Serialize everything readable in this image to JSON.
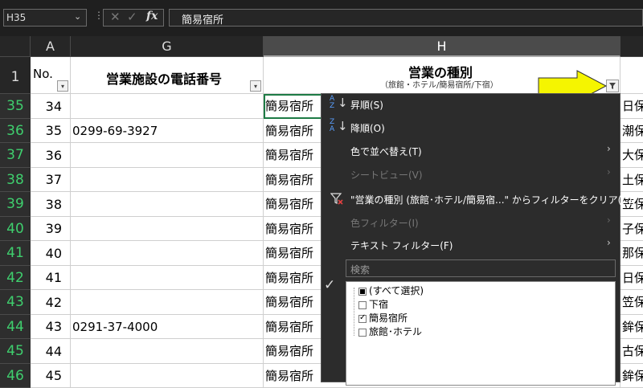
{
  "formula_bar": {
    "name_box": "H35",
    "fx": "fx",
    "content": "簡易宿所"
  },
  "columns": [
    "A",
    "G",
    "H"
  ],
  "header_row": {
    "row_number": "1",
    "A": "No.",
    "G": "営業施設の電話番号",
    "H_title": "営業の種別",
    "H_sub": "（旅館・ホテル/簡易宿所/下宿）"
  },
  "rows": [
    {
      "rn": "35",
      "a": "34",
      "g": "",
      "h": "簡易宿所",
      "i": "日保"
    },
    {
      "rn": "36",
      "a": "35",
      "g": "0299-69-3927",
      "h": "簡易宿所",
      "i": "潮保"
    },
    {
      "rn": "37",
      "a": "36",
      "g": "",
      "h": "簡易宿所",
      "i": "大保"
    },
    {
      "rn": "38",
      "a": "37",
      "g": "",
      "h": "簡易宿所",
      "i": "土保"
    },
    {
      "rn": "39",
      "a": "38",
      "g": "",
      "h": "簡易宿所",
      "i": "笠保"
    },
    {
      "rn": "40",
      "a": "39",
      "g": "",
      "h": "簡易宿所",
      "i": "子保"
    },
    {
      "rn": "41",
      "a": "40",
      "g": "",
      "h": "簡易宿所",
      "i": "那保"
    },
    {
      "rn": "42",
      "a": "41",
      "g": "",
      "h": "簡易宿所",
      "i": "日保"
    },
    {
      "rn": "43",
      "a": "42",
      "g": "",
      "h": "簡易宿所",
      "i": "笠保"
    },
    {
      "rn": "44",
      "a": "43",
      "g": "0291-37-4000",
      "h": "簡易宿所",
      "i": "鉾保"
    },
    {
      "rn": "45",
      "a": "44",
      "g": "",
      "h": "簡易宿所",
      "i": "古保"
    },
    {
      "rn": "46",
      "a": "45",
      "g": "",
      "h": "簡易宿所",
      "i": "鉾保"
    }
  ],
  "menu": {
    "sort_asc": "昇順(S)",
    "sort_desc": "降順(O)",
    "sort_by_color": "色で並べ替え(T)",
    "sheet_view": "シートビュー(V)",
    "clear_filter": "\"営業の種別 (旅館･ホテル/簡易宿...\" からフィルターをクリア(C)",
    "filter_by_color": "色フィルター(I)",
    "text_filter": "テキスト フィルター(F)",
    "search_placeholder": "検索",
    "list": [
      "(すべて選択)",
      "下宿",
      "簡易宿所",
      "旅館･ホテル"
    ]
  },
  "colors": {
    "callout_arrow": "#f5f500",
    "selected_row_header": "#3fcf6e"
  }
}
